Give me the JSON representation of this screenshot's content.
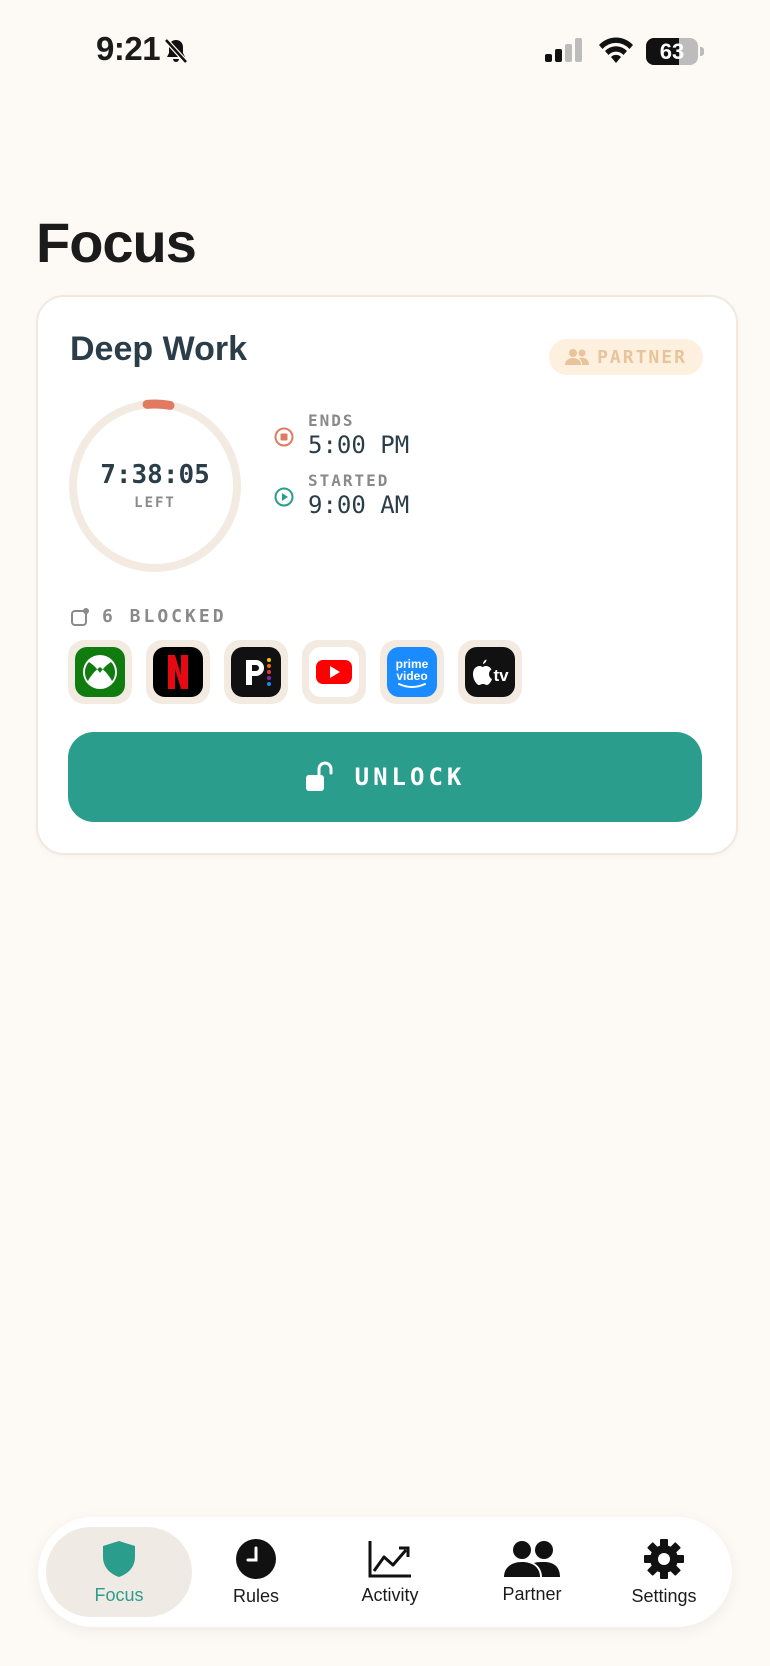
{
  "status_bar": {
    "time": "9:21",
    "battery": "63",
    "battery_level": 0.63
  },
  "page": {
    "title": "Focus"
  },
  "card": {
    "rule_name": "Deep Work",
    "badge": "PARTNER",
    "timer": {
      "value": "7:38:05",
      "label": "LEFT",
      "remaining_fraction": 0.955
    },
    "ends": {
      "label": "ENDS",
      "time": "5:00 PM"
    },
    "started": {
      "label": "STARTED",
      "time": "9:00 AM"
    },
    "blocked": {
      "label": "6 BLOCKED"
    },
    "apps": [
      "Xbox",
      "Netflix",
      "Peacock",
      "YouTube",
      "Prime Video",
      "Apple TV"
    ],
    "unlock_label": "UNLOCK"
  },
  "tabs": [
    {
      "label": "Focus",
      "icon": "shield-icon",
      "active": true
    },
    {
      "label": "Rules",
      "icon": "clock-icon"
    },
    {
      "label": "Activity",
      "icon": "chart-icon"
    },
    {
      "label": "Partner",
      "icon": "people-icon"
    },
    {
      "label": "Settings",
      "icon": "gear-icon"
    }
  ],
  "colors": {
    "accent": "#2a9d8c",
    "ends": "#e07b62",
    "ring_track": "#f3ebe2",
    "background": "#fdfaf5"
  }
}
